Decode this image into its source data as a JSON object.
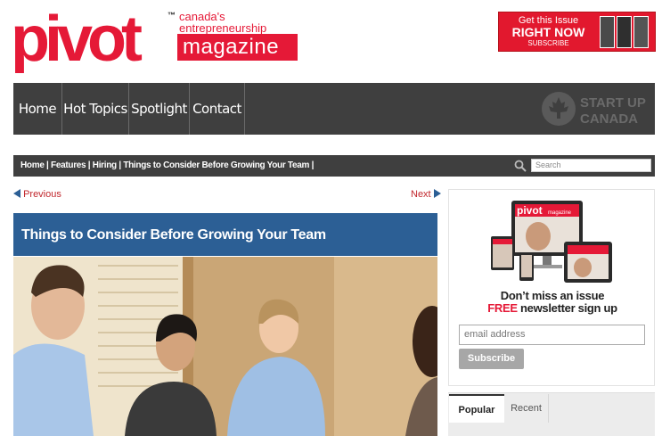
{
  "logo": {
    "wordmark": "pivot",
    "tm": "™",
    "tagline_line1": "canada's",
    "tagline_line2": "entrepreneurship",
    "magazine": "magazine"
  },
  "promo": {
    "line1": "Get this Issue",
    "line2": "RIGHT NOW",
    "line3": "SUBSCRIBE"
  },
  "nav": {
    "items": [
      "Home",
      "Hot Topics",
      "Spotlight",
      "Contact"
    ],
    "partner_logo": {
      "line1": "START UP",
      "line2": "CANADA"
    }
  },
  "breadcrumb": {
    "text": "Home | Features | Hiring | Things to Consider Before Growing Your Team |"
  },
  "search": {
    "placeholder": "Search"
  },
  "pager": {
    "previous": "Previous",
    "next": "Next"
  },
  "article": {
    "title": "Things to Consider Before Growing Your Team"
  },
  "sidebar": {
    "headline": "Don’t miss an issue",
    "free": "FREE",
    "newsletter": " newsletter sign up",
    "email_placeholder": "email address",
    "subscribe": "Subscribe",
    "device_wordmark": "pivot",
    "device_magazine": "magazine"
  },
  "tabs": {
    "popular": "Popular",
    "recent": "Recent"
  },
  "colors": {
    "brand_red": "#e51937",
    "nav_gray": "#3f3f3f",
    "title_blue": "#2c5f95"
  }
}
